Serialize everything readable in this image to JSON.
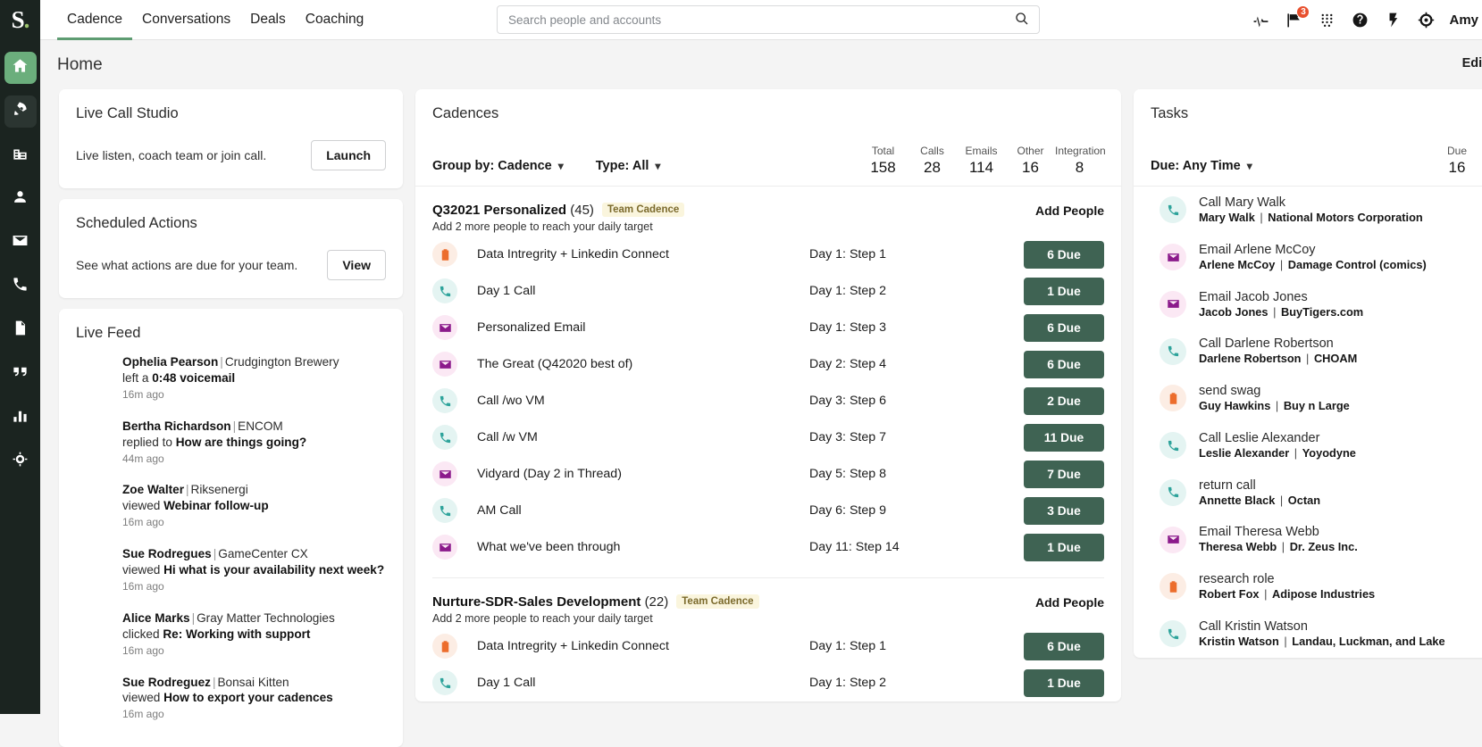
{
  "brand": {
    "logo_letter": "S",
    "logo_dot": ".",
    "accent_green": "#5E9C72",
    "dark_green": "#3F6353",
    "rail_bg": "#1B2420"
  },
  "topbar": {
    "tabs": [
      {
        "label": "Cadence",
        "active": true
      },
      {
        "label": "Conversations",
        "active": false
      },
      {
        "label": "Deals",
        "active": false
      },
      {
        "label": "Coaching",
        "active": false
      }
    ],
    "search": {
      "placeholder": "Search people and accounts",
      "value": "",
      "icon": "search-icon"
    },
    "tools": [
      {
        "icon": "activity-pulse-icon",
        "badge": null
      },
      {
        "icon": "chat-flag-icon",
        "badge": "3"
      },
      {
        "icon": "grid-dots-icon",
        "badge": null
      },
      {
        "icon": "help-circle-icon",
        "badge": null
      },
      {
        "icon": "lightning-bolt-icon",
        "badge": null
      },
      {
        "icon": "target-crosshair-icon",
        "badge": null
      }
    ],
    "username": "Amy"
  },
  "rail": {
    "items": [
      {
        "icon": "home-icon",
        "state": "active"
      },
      {
        "icon": "rocket-icon",
        "state": "semi"
      },
      {
        "icon": "building-icon",
        "state": "plain"
      },
      {
        "icon": "person-icon",
        "state": "plain"
      },
      {
        "icon": "envelope-icon",
        "state": "plain"
      },
      {
        "icon": "phone-icon",
        "state": "plain"
      },
      {
        "icon": "document-icon",
        "state": "plain"
      },
      {
        "icon": "quote-icon",
        "state": "plain"
      },
      {
        "icon": "bar-chart-icon",
        "state": "plain"
      },
      {
        "icon": "target-icon",
        "state": "plain"
      }
    ]
  },
  "page": {
    "title": "Home",
    "edit_label": "Edit"
  },
  "live_call_studio": {
    "title": "Live Call Studio",
    "description": "Live listen, coach team or join call.",
    "button_label": "Launch"
  },
  "scheduled_actions": {
    "title": "Scheduled Actions",
    "description": "See what actions are due for your team.",
    "button_label": "View"
  },
  "live_feed": {
    "title": "Live Feed",
    "items": [
      {
        "who": "Ophelia Pearson",
        "org": "Crudgington Brewery",
        "verb": "left a",
        "object": "0:48 voicemail",
        "time": "16m ago"
      },
      {
        "who": "Bertha Richardson",
        "org": "ENCOM",
        "verb": "replied to",
        "object": "How are things going?",
        "time": "44m ago"
      },
      {
        "who": "Zoe Walter",
        "org": "Riksenergi",
        "verb": "viewed",
        "object": "Webinar follow-up",
        "time": "16m ago"
      },
      {
        "who": "Sue Rodregues",
        "org": "GameCenter CX",
        "verb": "viewed",
        "object": "Hi what is your availability next week?",
        "time": "16m ago"
      },
      {
        "who": "Alice Marks",
        "org": "Gray Matter Technologies",
        "verb": "clicked",
        "object": "Re: Working with support",
        "time": "16m ago"
      },
      {
        "who": "Sue Rodreguez",
        "org": "Bonsai Kitten",
        "verb": "viewed",
        "object": "How to export your cadences",
        "time": "16m ago"
      }
    ]
  },
  "cadences": {
    "title": "Cadences",
    "group_by": {
      "label": "Group by: Cadence",
      "chevron": "chevron-down-icon"
    },
    "type_filter": {
      "label": "Type: All",
      "chevron": "chevron-down-icon"
    },
    "metrics": [
      {
        "label": "Total",
        "value": "158"
      },
      {
        "label": "Calls",
        "value": "28"
      },
      {
        "label": "Emails",
        "value": "114"
      },
      {
        "label": "Other",
        "value": "16"
      },
      {
        "label": "Integration",
        "value": "8"
      }
    ],
    "add_people_label": "Add People",
    "groups": [
      {
        "name": "Q32021 Personalized",
        "count": "(45)",
        "badge": "Team Cadence",
        "subtitle": "Add 2 more people to reach your daily target",
        "steps": [
          {
            "icon": "task-icon",
            "type": "task",
            "name": "Data Intregrity + Linkedin Connect",
            "day": "Day 1: Step 1",
            "due": "6 Due"
          },
          {
            "icon": "phone-icon",
            "type": "call",
            "name": "Day 1 Call",
            "day": "Day 1: Step 2",
            "due": "1 Due"
          },
          {
            "icon": "envelope-icon",
            "type": "email",
            "name": "Personalized Email",
            "day": "Day 1: Step 3",
            "due": "6 Due"
          },
          {
            "icon": "envelope-icon",
            "type": "email",
            "name": "The Great (Q42020 best of)",
            "day": "Day 2: Step 4",
            "due": "6 Due"
          },
          {
            "icon": "phone-icon",
            "type": "call",
            "name": "Call /wo VM",
            "day": "Day 3: Step 6",
            "due": "2 Due"
          },
          {
            "icon": "phone-icon",
            "type": "call",
            "name": "Call /w VM",
            "day": "Day 3: Step 7",
            "due": "11 Due"
          },
          {
            "icon": "envelope-icon",
            "type": "email",
            "name": "Vidyard (Day 2 in Thread)",
            "day": "Day 5: Step 8",
            "due": "7 Due"
          },
          {
            "icon": "phone-icon",
            "type": "call",
            "name": "AM Call",
            "day": "Day 6: Step 9",
            "due": "3 Due"
          },
          {
            "icon": "envelope-icon",
            "type": "email",
            "name": "What we've been through",
            "day": "Day 11: Step 14",
            "due": "1 Due"
          }
        ]
      },
      {
        "name": "Nurture-SDR-Sales Development",
        "count": "(22)",
        "badge": "Team Cadence",
        "subtitle": "Add 2 more people to reach your daily target",
        "steps": [
          {
            "icon": "task-icon",
            "type": "task",
            "name": "Data Intregrity + Linkedin Connect",
            "day": "Day 1: Step 1",
            "due": "6 Due"
          },
          {
            "icon": "phone-icon",
            "type": "call",
            "name": "Day 1 Call",
            "day": "Day 1: Step 2",
            "due": "1 Due"
          }
        ]
      }
    ]
  },
  "tasks": {
    "title": "Tasks",
    "due_filter": {
      "label": "Due: Any Time",
      "chevron": "chevron-down-icon"
    },
    "due_metric": {
      "label": "Due",
      "value": "16"
    },
    "items": [
      {
        "type": "call",
        "icon": "phone-icon",
        "title": "Call Mary Walk",
        "person": "Mary Walk",
        "org": "National Motors Corporation"
      },
      {
        "type": "email",
        "icon": "envelope-icon",
        "title": "Email Arlene McCoy",
        "person": "Arlene McCoy",
        "org": "Damage Control (comics)"
      },
      {
        "type": "email",
        "icon": "envelope-icon",
        "title": "Email Jacob Jones",
        "person": "Jacob Jones",
        "org": "BuyTigers.com"
      },
      {
        "type": "call",
        "icon": "phone-icon",
        "title": "Call Darlene Robertson",
        "person": "Darlene Robertson",
        "org": "CHOAM"
      },
      {
        "type": "task",
        "icon": "task-icon",
        "title": "send swag",
        "person": "Guy Hawkins",
        "org": "Buy n Large"
      },
      {
        "type": "call",
        "icon": "phone-icon",
        "title": "Call Leslie Alexander",
        "person": "Leslie Alexander",
        "org": "Yoyodyne"
      },
      {
        "type": "call",
        "icon": "phone-icon",
        "title": "return call",
        "person": "Annette Black",
        "org": "Octan"
      },
      {
        "type": "email",
        "icon": "envelope-icon",
        "title": "Email Theresa Webb",
        "person": "Theresa Webb",
        "org": "Dr. Zeus Inc."
      },
      {
        "type": "task",
        "icon": "task-icon",
        "title": "research role",
        "person": "Robert Fox",
        "org": "Adipose Industries"
      },
      {
        "type": "call",
        "icon": "phone-icon",
        "title": "Call Kristin Watson",
        "person": "Kristin Watson",
        "org": "Landau, Luckman, and Lake"
      }
    ]
  }
}
